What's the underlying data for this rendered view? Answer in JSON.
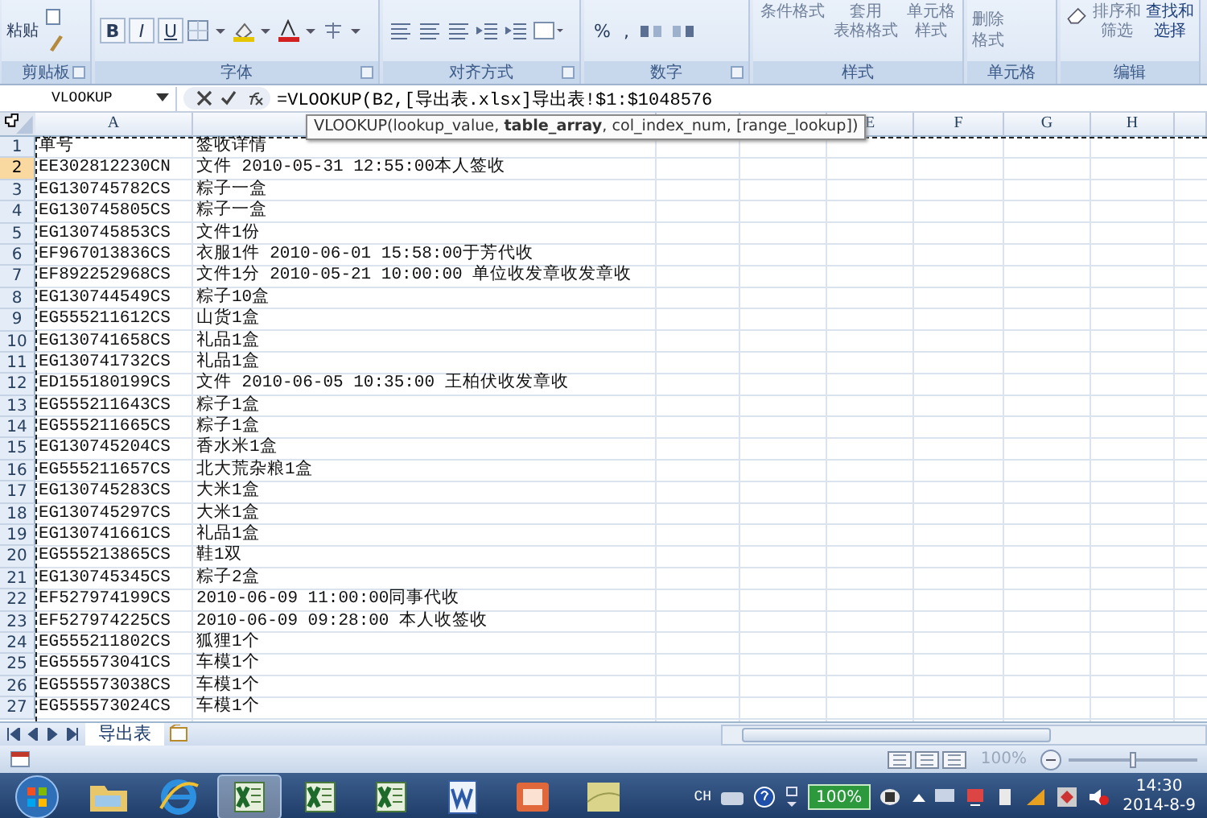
{
  "ribbon": {
    "groups": [
      {
        "kind": "clipboard",
        "label": "剪贴板",
        "buttons": [
          "粘贴"
        ]
      },
      {
        "kind": "font",
        "label": "字体",
        "buttons": [
          "B",
          "I",
          "U"
        ]
      },
      {
        "kind": "alignment",
        "label": "对齐方式"
      },
      {
        "kind": "number",
        "label": "数字",
        "buttons": [
          "%",
          ","
        ]
      },
      {
        "kind": "styles",
        "label": "样式",
        "buttons": [
          [
            "条件格式"
          ],
          [
            "套用",
            "表格格式"
          ],
          [
            "单元格",
            "样式"
          ]
        ]
      },
      {
        "kind": "cells",
        "label": "单元格",
        "buttons": [
          "删除",
          "格式"
        ]
      },
      {
        "kind": "editing",
        "label": "编辑",
        "buttons": [
          [
            "排序和",
            "筛选"
          ],
          [
            "查找和",
            "选择"
          ]
        ]
      }
    ]
  },
  "formula_bar": {
    "name_box": "VLOOKUP",
    "formula": "=VLOOKUP(B2,[导出表.xlsx]导出表!$1:$1048576",
    "tooltip": "VLOOKUP(lookup_value, **table_array**, col_index_num, [range_lookup])"
  },
  "sheet": {
    "columns": [
      "A",
      null,
      null,
      null,
      "E",
      "F",
      "G",
      "H",
      null
    ],
    "rows": [
      {
        "number": "1",
        "selected": false,
        "cells": [
          "单号",
          "签收详情"
        ]
      },
      {
        "number": "2",
        "selected": true,
        "cells": [
          "EE302812230CN",
          "文件 2010-05-31 12:55:00本人签收"
        ]
      },
      {
        "number": "3",
        "selected": false,
        "cells": [
          "EG130745782CS",
          "粽子一盒"
        ]
      },
      {
        "number": "4",
        "selected": false,
        "cells": [
          "EG130745805CS",
          "粽子一盒"
        ]
      },
      {
        "number": "5",
        "selected": false,
        "cells": [
          "EG130745853CS",
          "文件1份"
        ]
      },
      {
        "number": "6",
        "selected": false,
        "cells": [
          "EF967013836CS",
          "衣服1件 2010-06-01 15:58:00于芳代收"
        ]
      },
      {
        "number": "7",
        "selected": false,
        "cells": [
          "EF892252968CS",
          "文件1分 2010-05-21 10:00:00 单位收发章收发章收"
        ]
      },
      {
        "number": "8",
        "selected": false,
        "cells": [
          "EG130744549CS",
          "粽子10盒"
        ]
      },
      {
        "number": "9",
        "selected": false,
        "cells": [
          "EG555211612CS",
          "山货1盒"
        ]
      },
      {
        "number": "10",
        "selected": false,
        "cells": [
          "EG130741658CS",
          "礼品1盒"
        ]
      },
      {
        "number": "11",
        "selected": false,
        "cells": [
          "EG130741732CS",
          "礼品1盒"
        ]
      },
      {
        "number": "12",
        "selected": false,
        "cells": [
          "ED155180199CS",
          "文件 2010-06-05 10:35:00 王柏伏收发章收"
        ]
      },
      {
        "number": "13",
        "selected": false,
        "cells": [
          "EG555211643CS",
          "粽子1盒"
        ]
      },
      {
        "number": "14",
        "selected": false,
        "cells": [
          "EG555211665CS",
          "粽子1盒"
        ]
      },
      {
        "number": "15",
        "selected": false,
        "cells": [
          "EG130745204CS",
          "香水米1盒"
        ]
      },
      {
        "number": "16",
        "selected": false,
        "cells": [
          "EG555211657CS",
          "北大荒杂粮1盒"
        ]
      },
      {
        "number": "17",
        "selected": false,
        "cells": [
          "EG130745283CS",
          "大米1盒"
        ]
      },
      {
        "number": "18",
        "selected": false,
        "cells": [
          "EG130745297CS",
          "大米1盒"
        ]
      },
      {
        "number": "19",
        "selected": false,
        "cells": [
          "EG130741661CS",
          "礼品1盒"
        ]
      },
      {
        "number": "20",
        "selected": false,
        "cells": [
          "EG555213865CS",
          "鞋1双"
        ]
      },
      {
        "number": "21",
        "selected": false,
        "cells": [
          "EG130745345CS",
          "粽子2盒"
        ]
      },
      {
        "number": "22",
        "selected": false,
        "cells": [
          "EF527974199CS",
          "2010-06-09 11:00:00同事代收"
        ]
      },
      {
        "number": "23",
        "selected": false,
        "cells": [
          "EF527974225CS",
          "2010-06-09 09:28:00 本人收签收"
        ]
      },
      {
        "number": "24",
        "selected": false,
        "cells": [
          "EG555211802CS",
          "狐狸1个"
        ]
      },
      {
        "number": "25",
        "selected": false,
        "cells": [
          "EG555573041CS",
          "车模1个"
        ]
      },
      {
        "number": "26",
        "selected": false,
        "cells": [
          "EG555573038CS",
          "车模1个"
        ]
      },
      {
        "number": "27",
        "selected": false,
        "cells": [
          "EG555573024CS",
          "车模1个"
        ]
      }
    ]
  },
  "sheet_tabs": [
    {
      "label": "导出表",
      "selected": true
    }
  ],
  "status_bar": {
    "zoom": "100%",
    "zoom_slider": {
      "level": 0.5
    }
  },
  "taskbar": {
    "apps": [
      {
        "kind": "start",
        "selected": false
      },
      {
        "kind": "folder",
        "selected": false
      },
      {
        "kind": "browser",
        "selected": false
      },
      {
        "kind": "spreadsheet",
        "selected": true
      },
      {
        "kind": "spreadsheet",
        "selected": false
      },
      {
        "kind": "spreadsheet",
        "selected": false
      },
      {
        "kind": "document",
        "selected": false
      },
      {
        "kind": "slides",
        "selected": false
      },
      {
        "kind": "notes",
        "selected": false
      }
    ],
    "input_method": "CH",
    "battery": "100%",
    "time": "14:30",
    "date": "2014-8-9"
  }
}
